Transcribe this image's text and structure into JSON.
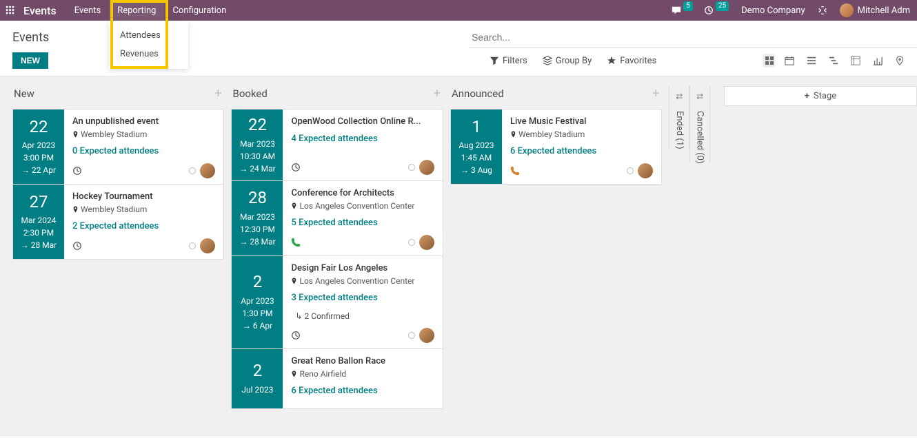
{
  "nav": {
    "brand": "Events",
    "items": [
      "Events",
      "Reporting",
      "Configuration"
    ],
    "dropdown": [
      "Attendees",
      "Revenues"
    ]
  },
  "topbar": {
    "msg_badge": "5",
    "clock_badge": "25",
    "company": "Demo Company",
    "user": "Mitchell Adm"
  },
  "cp": {
    "title": "Events",
    "new_btn": "NEW",
    "search_placeholder": "Search...",
    "filters": "Filters",
    "groupby": "Group By",
    "favorites": "Favorites"
  },
  "kanban": {
    "columns": [
      {
        "title": "New",
        "cards": [
          {
            "day": "22",
            "month": "Apr 2023",
            "time": "3:00 PM",
            "end": "22 Apr",
            "title": "An unpublished event",
            "location": "Wembley Stadium",
            "attendees": "0 Expected attendees",
            "icon": "clock",
            "avatar": true
          },
          {
            "day": "27",
            "month": "Mar 2024",
            "time": "2:30 PM",
            "end": "28 Mar",
            "title": "Hockey Tournament",
            "location": "Wembley Stadium",
            "attendees": "2 Expected attendees",
            "icon": "clock",
            "avatar": true
          }
        ]
      },
      {
        "title": "Booked",
        "cards": [
          {
            "day": "22",
            "month": "Mar 2023",
            "time": "10:30 AM",
            "end": "24 Mar",
            "title": "OpenWood Collection Online R...",
            "location": "",
            "attendees": "4 Expected attendees",
            "icon": "clock",
            "avatar": true
          },
          {
            "day": "28",
            "month": "Mar 2023",
            "time": "12:30 PM",
            "end": "28 Mar",
            "title": "Conference for Architects",
            "location": "Los Angeles Convention Center",
            "attendees": "5 Expected attendees",
            "icon": "phone-green",
            "avatar": true
          },
          {
            "day": "2",
            "month": "Apr 2023",
            "time": "1:30 PM",
            "end": "6 Apr",
            "title": "Design Fair Los Angeles",
            "location": "Los Angeles Convention Center",
            "attendees": "3 Expected attendees",
            "confirmed": "2 Confirmed",
            "icon": "clock",
            "avatar": true
          },
          {
            "day": "2",
            "month": "Jul 2023",
            "time": "",
            "end": "",
            "title": "Great Reno Ballon Race",
            "location": "Reno Airfield",
            "attendees": "6 Expected attendees",
            "icon": "",
            "avatar": false
          }
        ]
      },
      {
        "title": "Announced",
        "cards": [
          {
            "day": "1",
            "month": "Aug 2023",
            "time": "1:45 AM",
            "end": "3 Aug",
            "title": "Live Music Festival",
            "location": "Wembley Stadium",
            "attendees": "6 Expected attendees",
            "icon": "phone-orange",
            "avatar": true
          }
        ]
      }
    ],
    "folded": [
      {
        "label": "Ended (1)"
      },
      {
        "label": "Cancelled (0)"
      }
    ],
    "add_stage": "Stage"
  }
}
